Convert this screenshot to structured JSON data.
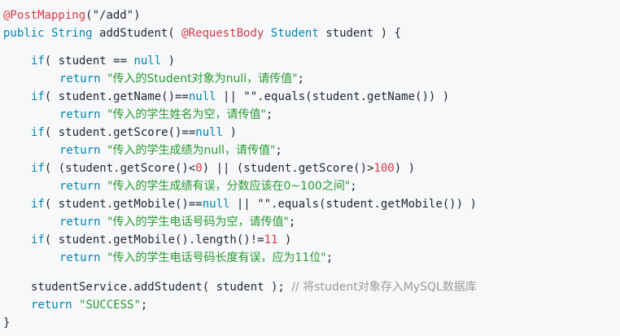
{
  "code": {
    "l1": {
      "annotation": "@PostMapping",
      "args": "(\"/add\")"
    },
    "l2": {
      "kw_public": "public",
      "type_string": "String",
      "method": " addStudent( ",
      "annotation": "@RequestBody",
      "type_student": "Student",
      "param": " student ) {"
    },
    "l4": {
      "kw_if": "if",
      "open": "( student == ",
      "kw_null": "null",
      "close": " )"
    },
    "l5": {
      "kw_return": "return",
      "str": "\"传入的Student对象为null，请传值\"",
      "end": ";"
    },
    "l6": {
      "kw_if": "if",
      "open": "( student.getName()==",
      "kw_null": "null",
      "close": " || \"\".equals(student.getName()) )"
    },
    "l7": {
      "kw_return": "return",
      "str": "\"传入的学生姓名为空，请传值\"",
      "end": ";"
    },
    "l8": {
      "kw_if": "if",
      "open": "( student.getScore()==",
      "kw_null": "null",
      "close": " )"
    },
    "l9": {
      "kw_return": "return",
      "str": "\"传入的学生成绩为null，请传值\"",
      "end": ";"
    },
    "l10": {
      "kw_if": "if",
      "open": "( (student.getScore()<",
      "num1": "0",
      "mid": ") || (student.getScore()>",
      "num2": "100",
      "close": ") )"
    },
    "l11": {
      "kw_return": "return",
      "str": "\"传入的学生成绩有误，分数应该在0~100之间\"",
      "end": ";"
    },
    "l12": {
      "kw_if": "if",
      "open": "( student.getMobile()==",
      "kw_null": "null",
      "close": " || \"\".equals(student.getMobile()) )"
    },
    "l13": {
      "kw_return": "return",
      "str": "\"传入的学生电话号码为空，请传值\"",
      "end": ";"
    },
    "l14": {
      "kw_if": "if",
      "open": "( student.getMobile().length()!=",
      "num": "11",
      "close": " )"
    },
    "l15": {
      "kw_return": "return",
      "str": "\"传入的学生电话号码长度有误，应为11位\"",
      "end": ";"
    },
    "l17": {
      "call": "studentService.addStudent( student ); ",
      "comment": "// 将student对象存入MySQL数据库"
    },
    "l18": {
      "kw_return": "return",
      "str": "\"SUCCESS\"",
      "end": ";"
    },
    "l19": {
      "brace": "}"
    }
  },
  "colors": {
    "background": "#f6f8fa",
    "annotation": "#d73a49",
    "keyword": "#0086b3",
    "string": "#2a9a31",
    "comment": "#999999",
    "plain": "#24292e"
  }
}
